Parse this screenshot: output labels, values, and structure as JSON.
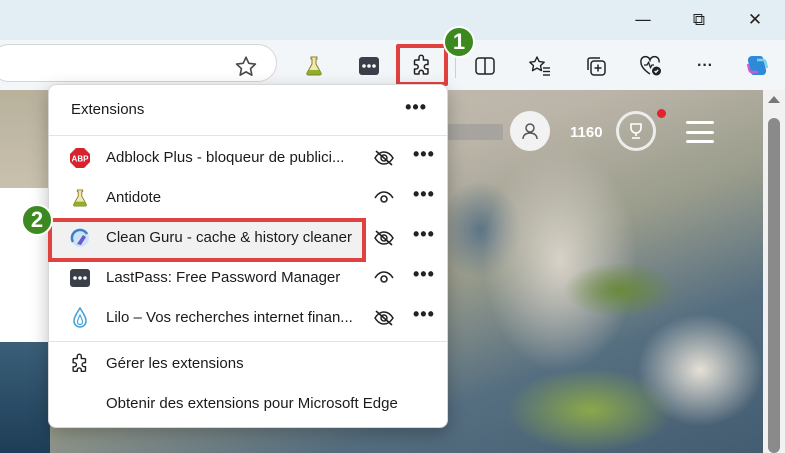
{
  "window": {
    "minimize_glyph": "—",
    "restore_glyph": "⧉",
    "close_glyph": "✕"
  },
  "toolbar": {
    "icons": [
      "favorite-star-icon",
      "antidote-icon",
      "lastpass-icon",
      "extensions-puzzle-icon",
      "split-screen-icon",
      "favorites-icon",
      "collections-icon",
      "browser-essentials-icon",
      "more-icon",
      "copilot-icon"
    ]
  },
  "annotations": {
    "step1": "1",
    "step2": "2",
    "highlight_color": "#e0423f",
    "badge_color": "#3c8a1f"
  },
  "page": {
    "score": "1160"
  },
  "extensions_popup": {
    "title": "Extensions",
    "more": "•••",
    "items": [
      {
        "name": "Adblock Plus - bloqueur de publici...",
        "icon": "adblock-plus-icon",
        "visibility": "hidden",
        "more": "•••"
      },
      {
        "name": "Antidote",
        "icon": "antidote-flask-icon",
        "visibility": "visible",
        "more": "•••"
      },
      {
        "name": "Clean Guru - cache & history cleaner",
        "icon": "clean-guru-icon",
        "visibility": "hidden",
        "more": "•••"
      },
      {
        "name": "LastPass: Free Password Manager",
        "icon": "lastpass-icon",
        "visibility": "visible",
        "more": "•••"
      },
      {
        "name": "Lilo – Vos recherches internet finan...",
        "icon": "lilo-drop-icon",
        "visibility": "hidden",
        "more": "•••"
      }
    ],
    "manage_label": "Gérer les extensions",
    "get_label": "Obtenir des extensions pour Microsoft Edge"
  }
}
